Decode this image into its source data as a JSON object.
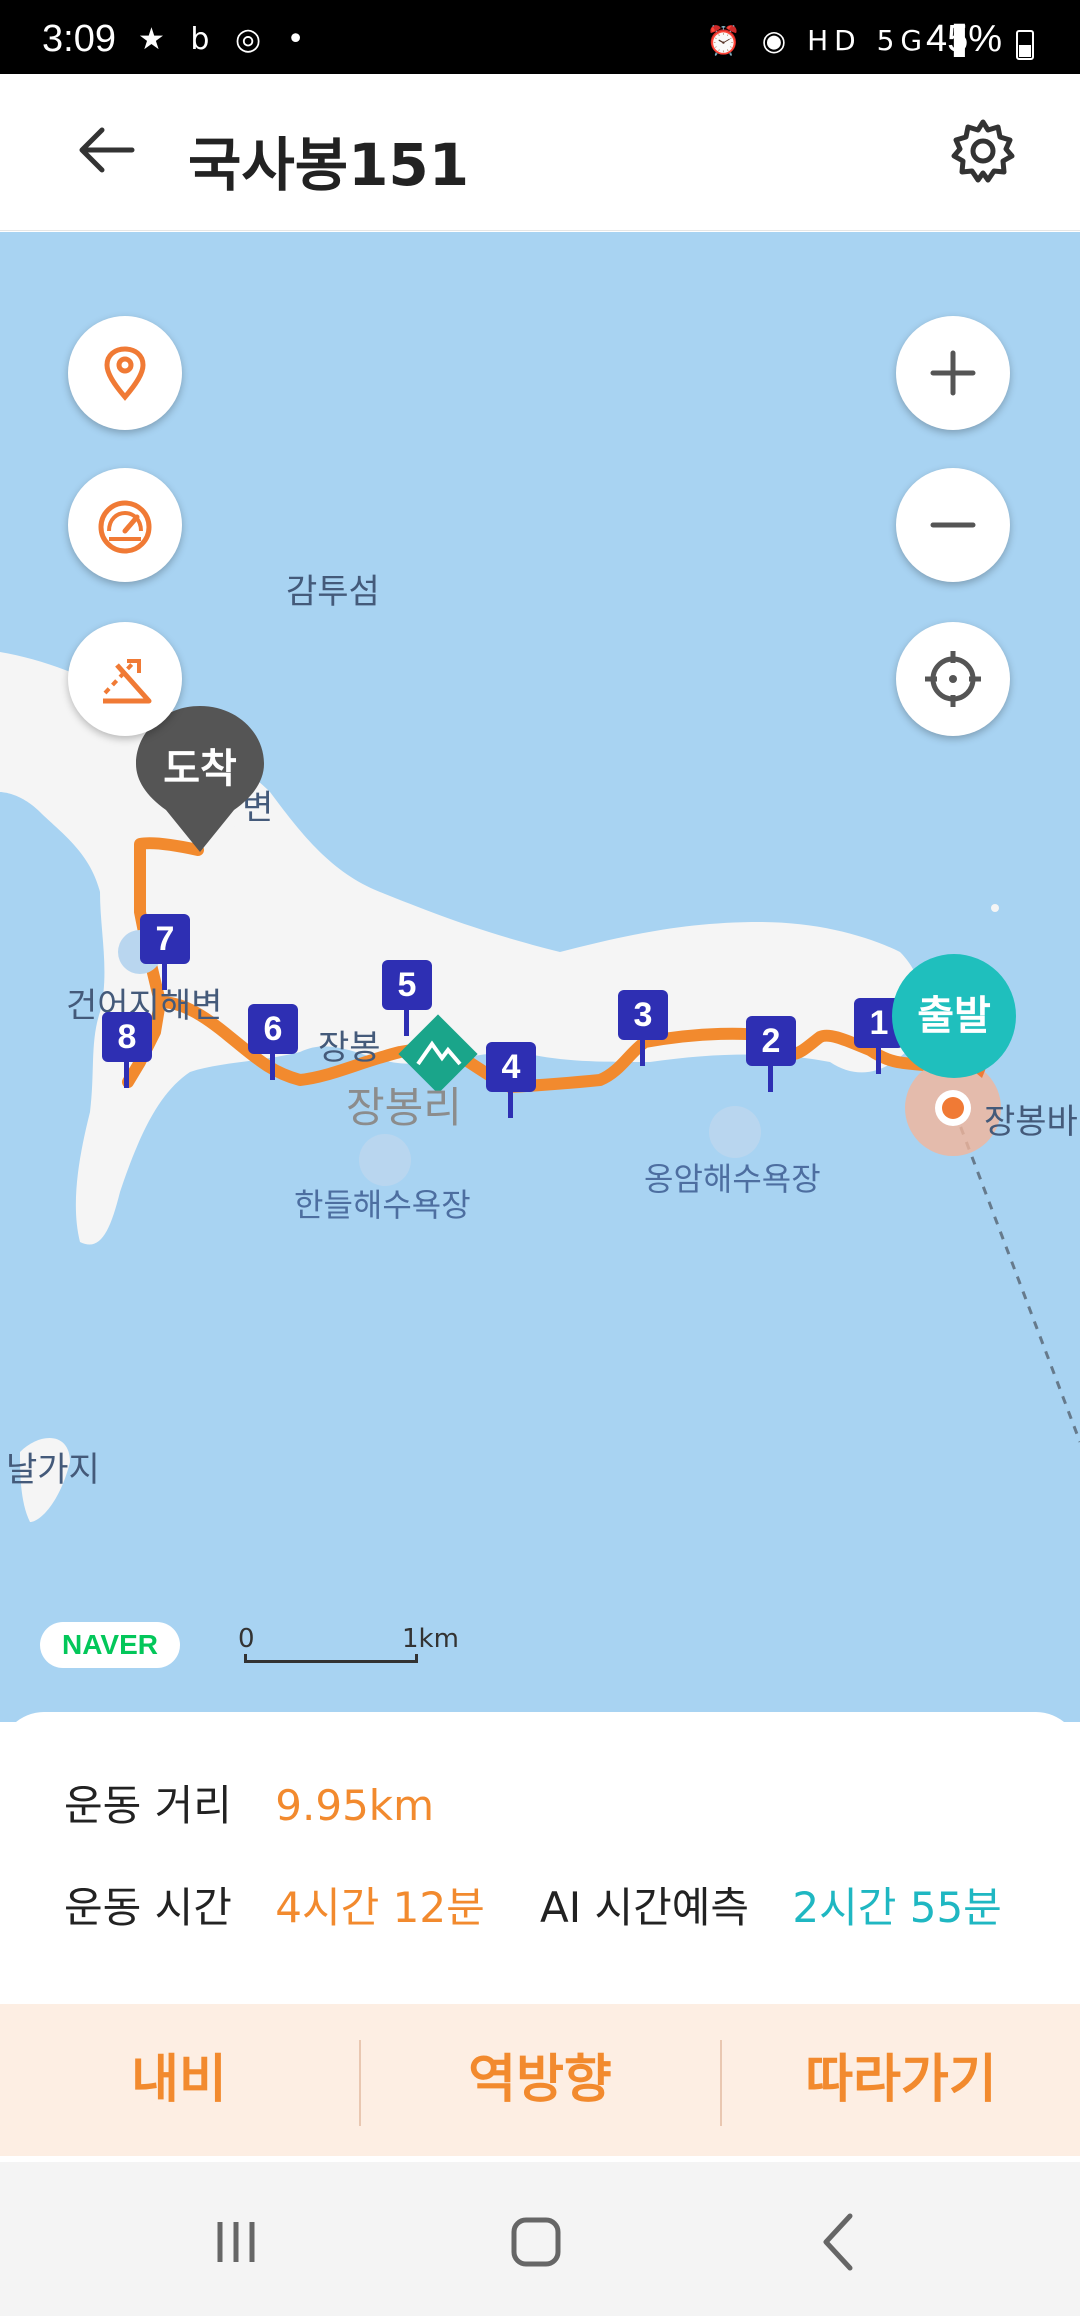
{
  "status_bar": {
    "time": "3:09",
    "left_icons": "★ b ◎ •",
    "right_icons": "⏰ ◉ HD 5G ▐",
    "battery": "45%"
  },
  "header": {
    "title": "국사봉151",
    "back_icon": "arrow-left-icon",
    "settings_icon": "gear-icon"
  },
  "map": {
    "labels": {
      "gamtuseom": "감투섬",
      "geoneo": "건어지해변",
      "jangbong_small": "장봉",
      "jangbongri": "장봉리",
      "handeul": "한들해수욕장",
      "ongam": "옹암해수욕장",
      "jangbongba": "장봉바",
      "nalgaji": "날가지",
      "byeon": "변"
    },
    "markers": [
      "1",
      "2",
      "3",
      "4",
      "5",
      "6",
      "7",
      "8"
    ],
    "start_label": "출발",
    "arrive_label": "도착",
    "naver_logo": "NAVER",
    "scale_zero": "0",
    "scale_km": "1km",
    "buttons": {
      "location": "location-pin-icon",
      "speed": "speedometer-icon",
      "slope": "slope-icon",
      "zoom_in": "plus-icon",
      "zoom_out": "minus-icon",
      "my_location": "crosshair-icon"
    },
    "colors": {
      "route": "#f28a2e",
      "marker": "#2e2fb3",
      "start": "#1fbfbd",
      "sea": "#a8d3f2",
      "land": "#f5f5f5"
    }
  },
  "summary": {
    "distance_label": "운동 거리",
    "distance_value": "9.95km",
    "time_label": "운동 시간",
    "time_value": "4시간 12분",
    "ai_label": "AI 시간예측",
    "ai_value": "2시간 55분"
  },
  "actions": {
    "nav": "내비",
    "reverse": "역방향",
    "follow": "따라가기"
  },
  "navbar": {
    "recent": "recent-apps-icon",
    "home": "home-icon",
    "back": "back-icon"
  }
}
